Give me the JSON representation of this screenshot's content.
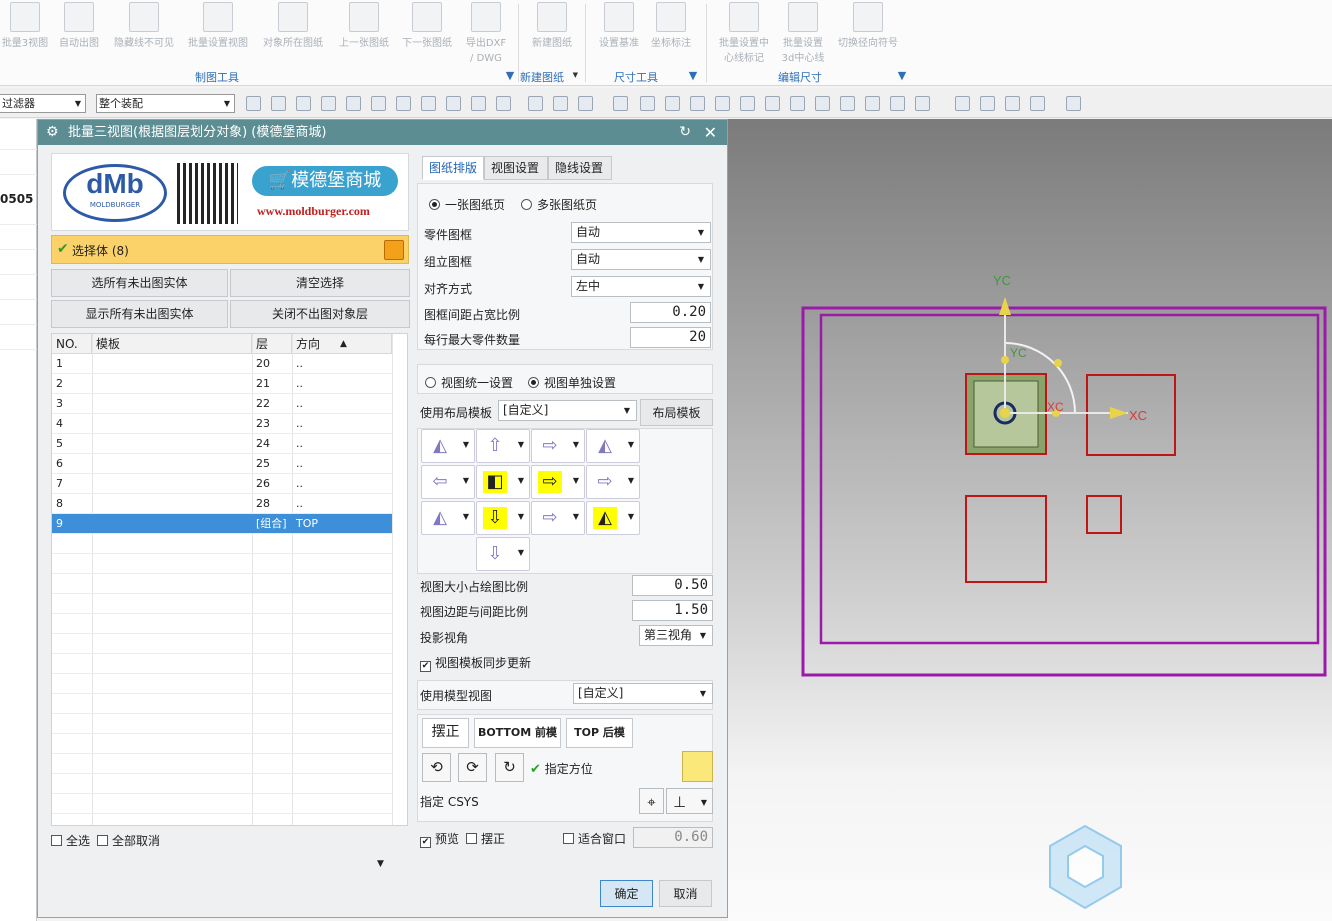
{
  "ribbon": {
    "buttons": [
      {
        "label": "批量3视图"
      },
      {
        "label": "自动出图"
      },
      {
        "label": "隐藏线不可见"
      },
      {
        "label": "批量设置视图"
      },
      {
        "label": "对象所在图纸"
      },
      {
        "label": "上一张图纸"
      },
      {
        "label": "下一张图纸"
      },
      {
        "label": "导出DXF",
        "label2": "/ DWG"
      },
      {
        "label": "新建图纸"
      },
      {
        "label": "设置基准"
      },
      {
        "label": "坐标标注"
      },
      {
        "label": "批量设置中",
        "label2": "心线标记"
      },
      {
        "label": "批量设置",
        "label2": "3d中心线"
      },
      {
        "label": "切换径向符号"
      }
    ],
    "groups": [
      "制图工具",
      "新建图纸",
      "尺寸工具",
      "编辑尺寸"
    ]
  },
  "toolbar": {
    "filter": "过滤器",
    "assembly": "整个装配"
  },
  "left_strip": {
    "value": "0505"
  },
  "dialog": {
    "title": "批量三视图(根据图层划分对象)  (模德堡商城)",
    "banner": {
      "logo": "dMb",
      "logo_sub": "MOLDBURGER",
      "shop": "模德堡商城",
      "url": "www.moldburger.com"
    },
    "select_body": "选择体 (8)",
    "buttons": {
      "select_all_unexported": "选所有未出图实体",
      "clear_selection": "清空选择",
      "show_all_unexported": "显示所有未出图实体",
      "close_non_layer": "关闭不出图对象层"
    },
    "table": {
      "headers": [
        "NO.",
        "模板",
        "层",
        "方向"
      ],
      "sort_icon": "▲",
      "rows": [
        {
          "no": "1",
          "template": "",
          "layer": "20",
          "dir": ".."
        },
        {
          "no": "2",
          "template": "",
          "layer": "21",
          "dir": ".."
        },
        {
          "no": "3",
          "template": "",
          "layer": "22",
          "dir": ".."
        },
        {
          "no": "4",
          "template": "",
          "layer": "23",
          "dir": ".."
        },
        {
          "no": "5",
          "template": "",
          "layer": "24",
          "dir": ".."
        },
        {
          "no": "6",
          "template": "",
          "layer": "25",
          "dir": ".."
        },
        {
          "no": "7",
          "template": "",
          "layer": "26",
          "dir": ".."
        },
        {
          "no": "8",
          "template": "",
          "layer": "28",
          "dir": ".."
        },
        {
          "no": "9",
          "template": "",
          "layer": "[组合]",
          "dir": "TOP"
        }
      ]
    },
    "select_all": "全选",
    "deselect_all": "全部取消",
    "tabs": [
      "图纸排版",
      "视图设置",
      "隐线设置"
    ],
    "sheet": {
      "single": "一张图纸页",
      "multi": "多张图纸页"
    },
    "part_frame": {
      "label": "零件图框",
      "value": "自动"
    },
    "asm_frame": {
      "label": "组立图框",
      "value": "自动"
    },
    "align": {
      "label": "对齐方式",
      "value": "左中"
    },
    "frame_spacing": {
      "label": "图框间距占宽比例",
      "value": "0.20"
    },
    "max_parts": {
      "label": "每行最大零件数量",
      "value": "20"
    },
    "view_mode": {
      "unified": "视图统一设置",
      "separate": "视图单独设置"
    },
    "layout_template": {
      "label": "使用布局模板",
      "value": "[自定义]",
      "button": "布局模板"
    },
    "view_size": {
      "label": "视图大小占绘图比例",
      "value": "0.50"
    },
    "view_margin": {
      "label": "视图边距与间距比例",
      "value": "1.50"
    },
    "projection": {
      "label": "投影视角",
      "value": "第三视角"
    },
    "sync_update": "视图模板同步更新",
    "model_view": {
      "label": "使用模型视图",
      "value": "[自定义]"
    },
    "orient_buttons": {
      "straighten": "摆正",
      "bottom": "BOTTOM 前模",
      "top": "TOP 后模"
    },
    "specify_orient": "指定方位",
    "specify_csys": "指定 CSYS",
    "preview": "预览",
    "preview_straighten": "摆正",
    "fit_window": "适合窗口",
    "fit_value": "0.60",
    "ok": "确定",
    "cancel": "取消"
  },
  "viewport": {
    "yc": "YC",
    "xc": "XC",
    "yc_small": "YC",
    "xc_small": "XC"
  },
  "colors": {
    "title_bar": "#5c8d93",
    "frame_purple": "#9c1aa8",
    "view_red": "#c01515",
    "select_blue": "#3c8fd8",
    "highlight_yellow": "#ffff00"
  }
}
